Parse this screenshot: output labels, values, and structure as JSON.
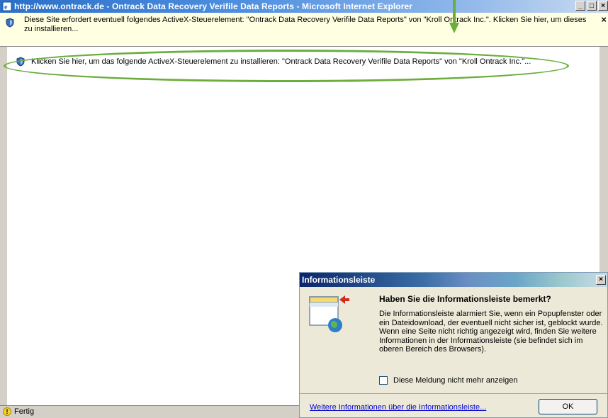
{
  "window": {
    "title": "http://www.ontrack.de - Ontrack Data Recovery Verifile Data Reports - Microsoft Internet Explorer",
    "minimize": "_",
    "maximize": "□",
    "close": "×",
    "icon": "ie-icon"
  },
  "infobar": {
    "icon": "shield-icon",
    "text": "Diese Site erfordert eventuell folgendes ActiveX-Steuerelement: \"Ontrack Data Recovery Verifile Data Reports\" von \"Kroll Ontrack Inc.\". Klicken Sie hier, um dieses zu installieren...",
    "close": "×"
  },
  "content": {
    "icon": "shield-icon",
    "install_text": "Klicken Sie hier, um das folgende ActiveX-Steuerelement zu installieren: \"Ontrack Data Recovery Verifile Data Reports\" von \"Kroll Ontrack Inc.\"..."
  },
  "statusbar": {
    "icon": "warning-icon",
    "text": "Fertig"
  },
  "dialog": {
    "title": "Informationsleiste",
    "close": "×",
    "heading": "Haben Sie die Informationsleiste bemerkt?",
    "body": "Die Informationsleiste alarmiert Sie, wenn ein Popupfenster oder ein Dateidownload, der eventuell nicht sicher ist, geblockt wurde. Wenn eine Seite nicht richtig angezeigt wird, finden Sie weitere Informationen in der Informationsleiste (sie befindet sich im oberen Bereich des Browsers).",
    "checkbox_label": "Diese Meldung nicht mehr anzeigen",
    "checkbox_checked": false,
    "link": "Weitere Informationen über die Informationsleiste...",
    "ok_label": "OK",
    "image_icon": "browser-window-icon"
  },
  "colors": {
    "annotation": "#6aae3b",
    "infobar_bg": "#ffffe1",
    "titlebar": "#2a6fc8"
  }
}
